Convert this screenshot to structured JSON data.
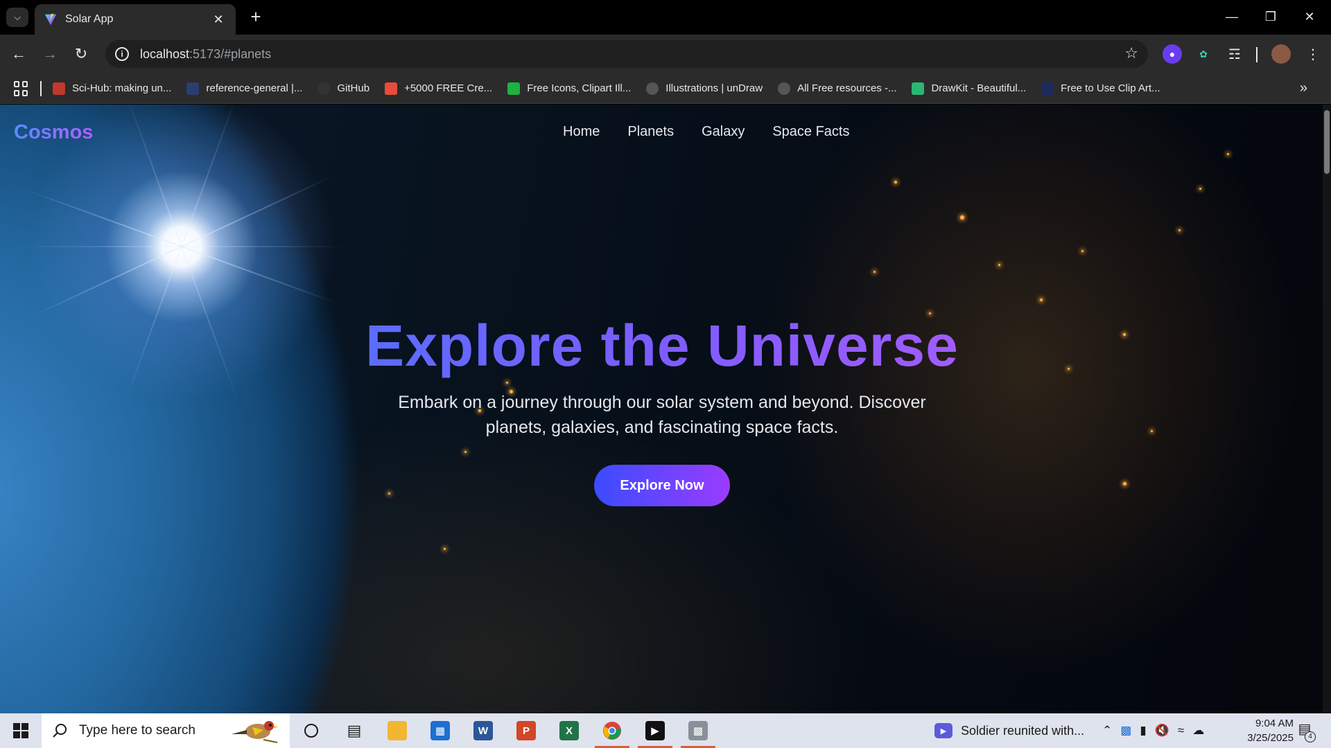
{
  "browser": {
    "tab_title": "Solar App",
    "url_host": "localhost",
    "url_rest": ":5173/#planets",
    "bookmarks": [
      {
        "label": "Sci-Hub: making un...",
        "icon": "scihub-icon",
        "color": "#c0392b"
      },
      {
        "label": "reference-general |...",
        "icon": "reference-icon",
        "color": "#2c3e70"
      },
      {
        "label": "GitHub",
        "icon": "github-icon",
        "color": "#333333"
      },
      {
        "label": "+5000 FREE Cre...",
        "icon": "creative-icon",
        "color": "#e74c3c"
      },
      {
        "label": "Free Icons, Clipart Ill...",
        "icon": "icons8-icon",
        "color": "#1fb141"
      },
      {
        "label": "Illustrations | unDraw",
        "icon": "undraw-icon",
        "color": "#555555"
      },
      {
        "label": "All Free resources -...",
        "icon": "globe-icon",
        "color": "#555555"
      },
      {
        "label": "DrawKit - Beautiful...",
        "icon": "drawkit-icon",
        "color": "#2bb673"
      },
      {
        "label": "Free to Use Clip Art...",
        "icon": "clipart-icon",
        "color": "#1d2a5c"
      }
    ]
  },
  "page": {
    "brand": "Cosmos",
    "nav": [
      "Home",
      "Planets",
      "Galaxy",
      "Space Facts"
    ],
    "hero_title": "Explore the Universe",
    "hero_subtitle": "Embark on a journey through our solar system and beyond. Discover planets, galaxies, and fascinating space facts.",
    "cta_label": "Explore Now"
  },
  "taskbar": {
    "search_placeholder": "Type here to search",
    "news_text": "Soldier reunited with...",
    "time": "9:04 AM",
    "date": "3/25/2025",
    "notification_count": "4"
  }
}
